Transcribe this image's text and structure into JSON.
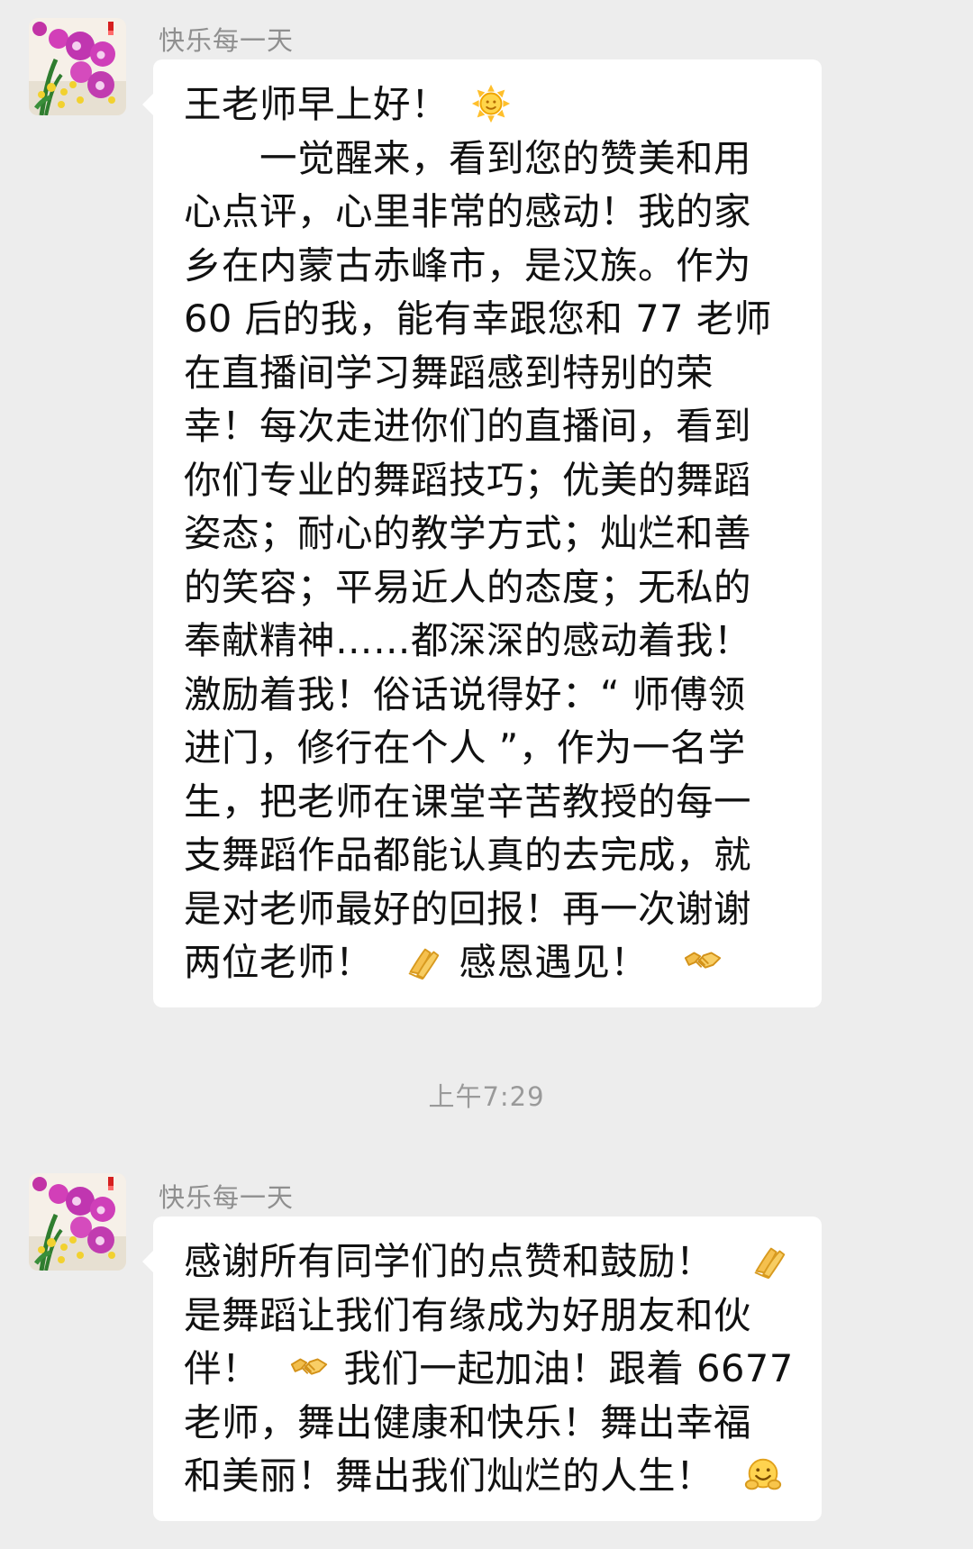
{
  "chat": {
    "messages": [
      {
        "sender": "快乐每一天",
        "lines": [
          "王老师早上好！",
          "　　一觉醒来，看到您的赞美和用",
          "心点评，心里非常的感动！我的家",
          "乡在内蒙古赤峰市，是汉族。作为",
          "60 后的我，能有幸跟您和 77 老师",
          "在直播间学习舞蹈感到特别的荣",
          "幸！每次走进你们的直播间，看到",
          "你们专业的舞蹈技巧；优美的舞蹈",
          "姿态；耐心的教学方式；灿烂和善",
          "的笑容；平易近人的态度；无私的",
          "奉献精神……都深深的感动着我！",
          "激励着我！俗话说得好：“ 师傅领",
          "进门，修行在个人 ”，作为一名学",
          "生，把老师在课堂辛苦教授的每一",
          "支舞蹈作品都能认真的去完成，就",
          "是对老师最好的回报！再一次谢谢",
          "两位老师！",
          "感恩遇见！"
        ],
        "emojis": [
          "sun-emoji",
          "folded-hands-emoji",
          "handshake-emoji"
        ]
      },
      {
        "sender": "快乐每一天",
        "lines": [
          "感谢所有同学们的点赞和鼓励！",
          "是舞蹈让我们有缘成为好朋友和伙",
          "伴！",
          "我们一起加油！跟着 6677",
          "老师，舞出健康和快乐！舞出幸福",
          "和美丽！舞出我们灿烂的人生！"
        ],
        "emojis": [
          "folded-hands-emoji",
          "handshake-emoji",
          "hugging-face-emoji"
        ]
      }
    ],
    "timestamp": "上午7:29"
  },
  "colors": {
    "background": "#ededed",
    "bubble": "#ffffff",
    "sender_name": "#8f8f8f",
    "timestamp": "#9a9a9a",
    "text": "#111111",
    "emoji_yellow": "#f6c343"
  }
}
